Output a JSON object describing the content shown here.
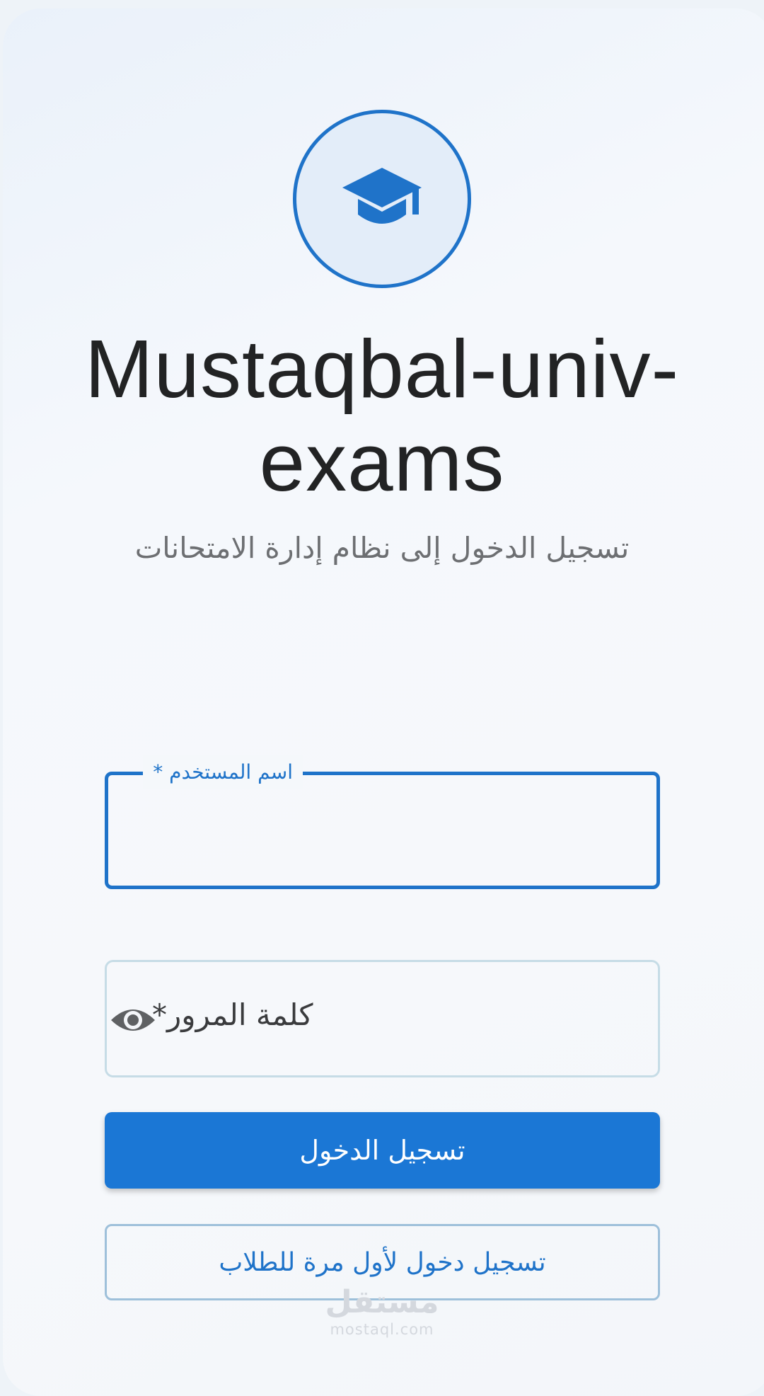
{
  "app": {
    "title": "Mustaqbal-univ-exams",
    "subtitle": "تسجيل الدخول إلى نظام إدارة الامتحانات"
  },
  "form": {
    "username_label": "اسم المستخدم *",
    "username_value": "",
    "password_label": "كلمة المرور*",
    "password_value": "",
    "login_label": "تسجيل الدخول",
    "first_login_label": "تسجيل دخول لأول مرة للطلاب"
  },
  "watermark": {
    "ar": "مستقل",
    "en": "mostaql.com"
  },
  "icons": {
    "logo": "graduation-cap-icon",
    "password_toggle": "eye-icon"
  },
  "colors": {
    "primary": "#1b77d5",
    "title": "#222324",
    "subtitle": "#6d6f72",
    "input_border_inactive": "#c6dce6"
  }
}
